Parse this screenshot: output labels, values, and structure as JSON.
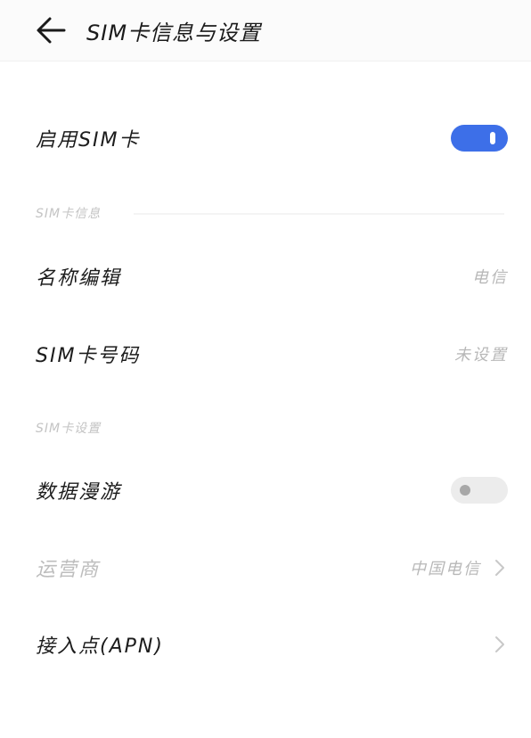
{
  "header": {
    "title": "SIM卡信息与设置",
    "back_icon": "arrow-left-icon"
  },
  "enable_sim": {
    "label": "启用SIM卡",
    "enabled": true,
    "toggle_color": "#3d6fe8"
  },
  "sim_info_section": {
    "title": "SIM卡信息",
    "items": [
      {
        "label": "名称编辑",
        "value": "电信"
      },
      {
        "label": "SIM卡号码",
        "value": "未设置"
      }
    ]
  },
  "sim_settings_section": {
    "title": "SIM卡设置",
    "data_roaming": {
      "label": "数据漫游",
      "enabled": false
    },
    "carrier": {
      "label": "运营商",
      "value": "中国电信",
      "disabled": true
    },
    "apn": {
      "label": "接入点(APN)"
    }
  },
  "colors": {
    "accent": "#3d6fe8",
    "secondary_text": "#b8b8b8",
    "disabled_text": "#bdbdbd",
    "section_header": "#c4c4c4"
  }
}
